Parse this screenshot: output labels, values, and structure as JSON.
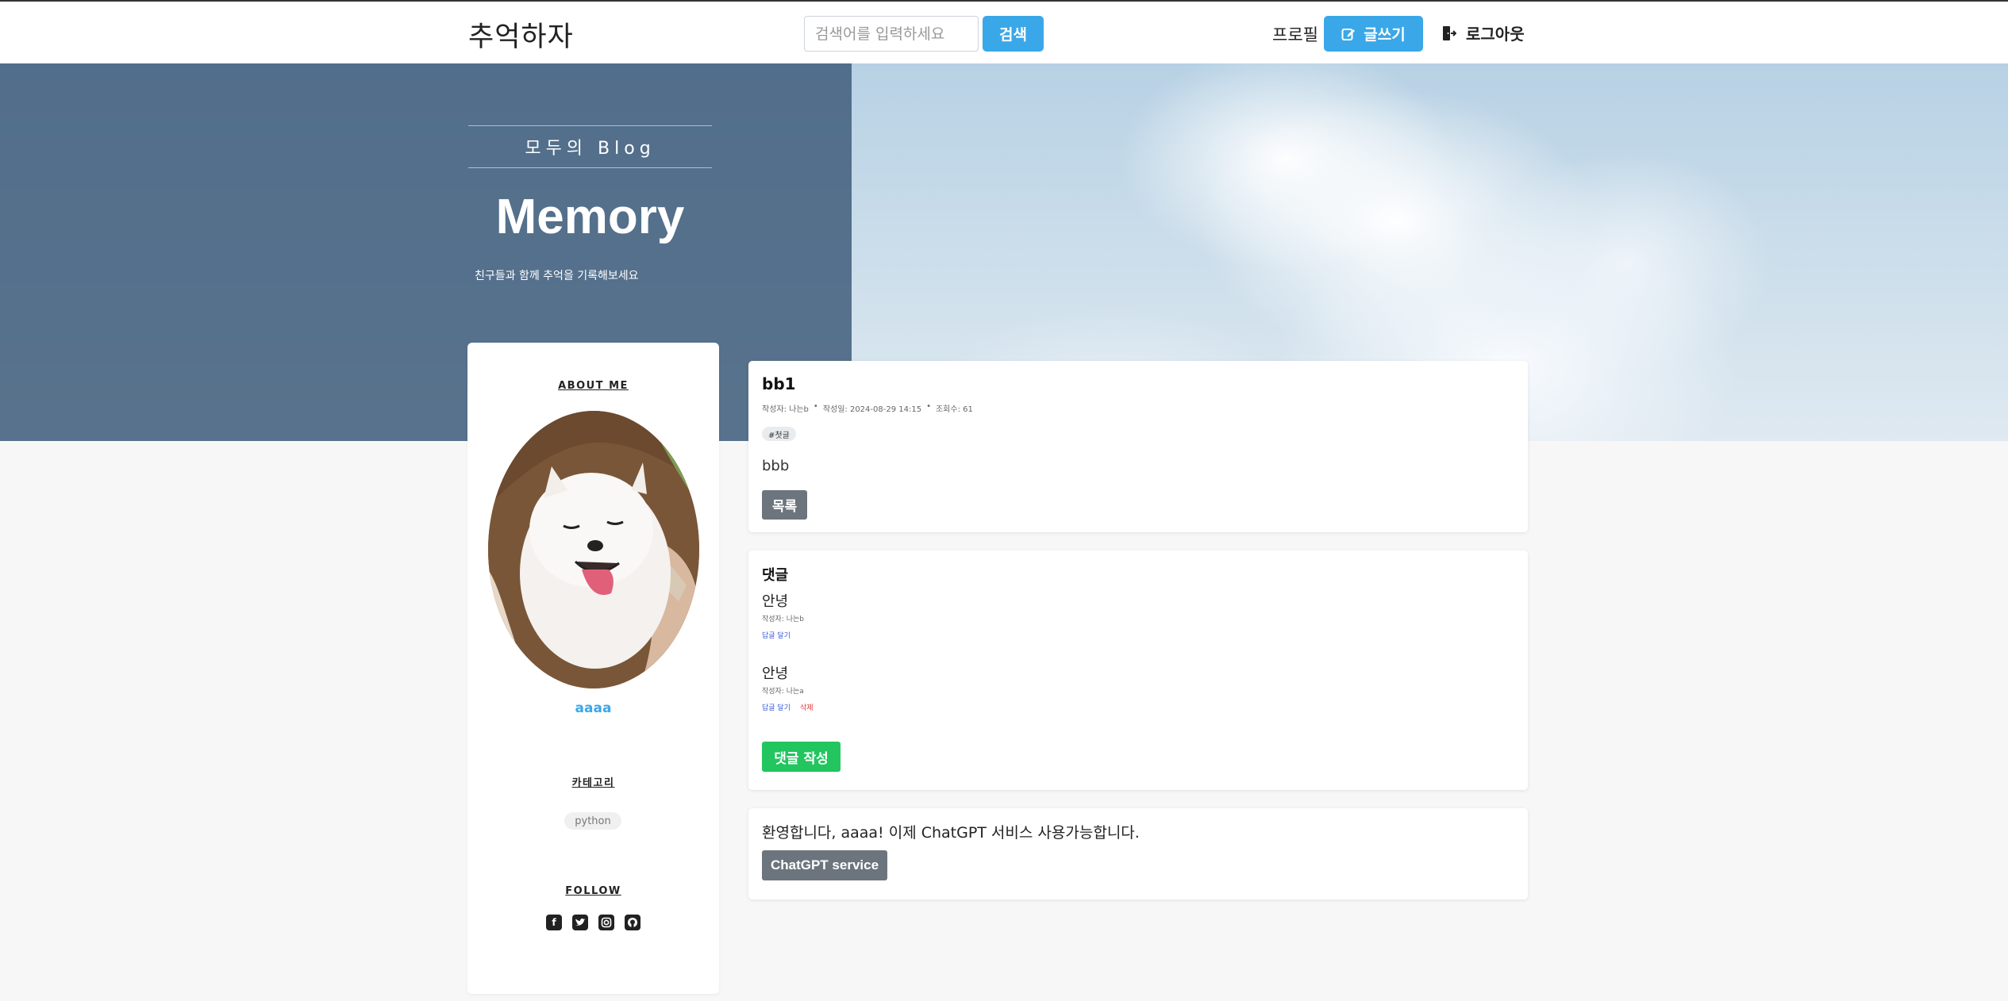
{
  "navbar": {
    "brand": "추억하자",
    "search_placeholder": "검색어를 입력하세요",
    "search_button": "검색",
    "profile_link": "프로필",
    "write_button": "글쓰기",
    "logout_link": "로그아웃",
    "write_icon": "edit-icon",
    "logout_icon": "logout-icon"
  },
  "hero": {
    "subtitle": "모두의 Blog",
    "title": "Memory",
    "description": "친구들과 함께 추억을 기록해보세요"
  },
  "sidebar": {
    "about_heading": "ABOUT ME",
    "username": "aaaa",
    "category_heading": "카테고리",
    "categories": [
      "python"
    ],
    "follow_heading": "FOLLOW",
    "social_icons": [
      "facebook-icon",
      "twitter-icon",
      "instagram-icon",
      "github-icon"
    ]
  },
  "post": {
    "title": "bb1",
    "author": "작성자: 나는b",
    "date": "작성일: 2024-08-29 14:15",
    "views": "조회수: 61",
    "separator": "•",
    "tag": "#첫글",
    "body": "bbb",
    "list_button": "목록"
  },
  "comments": {
    "heading": "댓글",
    "items": [
      {
        "text": "안녕",
        "author": "작성자: 나는b",
        "reply": "답글 달기",
        "delete": ""
      },
      {
        "text": "안녕",
        "author": "작성자: 나는a",
        "reply": "답글 달기",
        "delete": "삭제"
      }
    ],
    "write_button": "댓글 작성"
  },
  "gpt": {
    "message": "환영합니다, aaaa! 이제 ChatGPT 서비스 사용가능합니다.",
    "button": "ChatGPT service"
  },
  "colors": {
    "accent": "#3aa8e8",
    "secondary_button": "#6c757d",
    "success_button": "#22c55e",
    "hero_overlay": "#3a5876"
  }
}
